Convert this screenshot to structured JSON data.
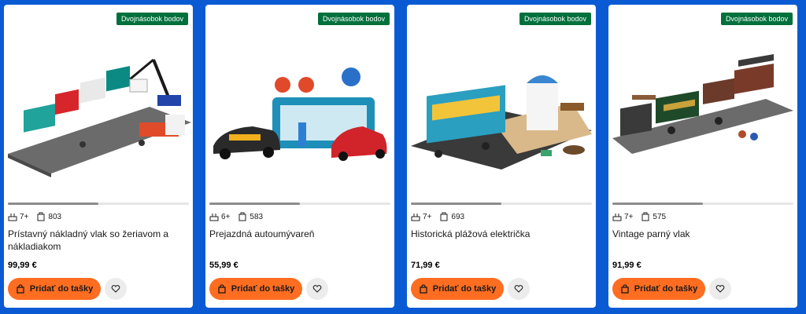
{
  "colors": {
    "page_background": "#0a5bd3",
    "badge": "#00703c",
    "cart_button": "#ff6d21",
    "progress_fill": "#8c8c8c"
  },
  "products": [
    {
      "badge": "Dvojnásobok bodov",
      "age": "7+",
      "pieces": "803",
      "title": "Prístavný nákladný vlak so žeriavom a nákladiakom",
      "price": "99,99 €",
      "cart_label": "Pridať do tašky",
      "image_progress": 0.5,
      "image_icon": "freight-train-image"
    },
    {
      "badge": "Dvojnásobok bodov",
      "age": "6+",
      "pieces": "583",
      "title": "Prejazdná autoumývareň",
      "price": "55,99 €",
      "cart_label": "Pridať do tašky",
      "image_progress": 0.5,
      "image_icon": "car-wash-image"
    },
    {
      "badge": "Dvojnásobok bodov",
      "age": "7+",
      "pieces": "693",
      "title": "Historická plážová električka",
      "price": "71,99 €",
      "cart_label": "Pridať do tašky",
      "image_progress": 0.5,
      "image_icon": "beach-tram-image"
    },
    {
      "badge": "Dvojnásobok bodov",
      "age": "7+",
      "pieces": "575",
      "title": "Vintage parný vlak",
      "price": "91,99 €",
      "cart_label": "Pridať do tašky",
      "image_progress": 0.5,
      "image_icon": "steam-train-image"
    }
  ]
}
